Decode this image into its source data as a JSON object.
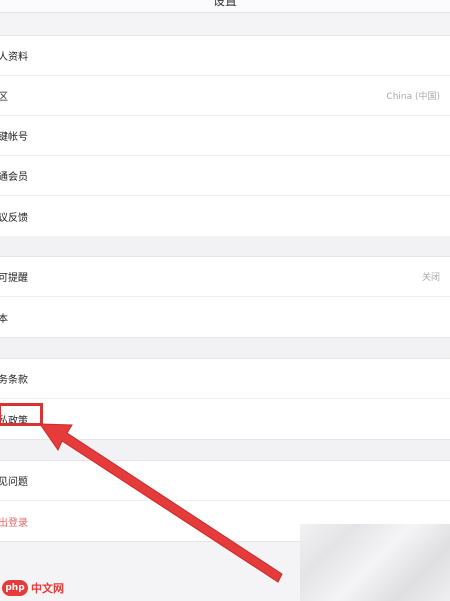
{
  "header": {
    "title": "设置"
  },
  "sections": [
    {
      "items": [
        {
          "name": "profile",
          "label": "人资料",
          "value": ""
        },
        {
          "name": "region",
          "label": "区",
          "value": "China (中国)"
        },
        {
          "name": "account",
          "label": "键帐号",
          "value": ""
        },
        {
          "name": "membership",
          "label": "通会员",
          "value": ""
        },
        {
          "name": "feedback",
          "label": "议反馈",
          "value": ""
        }
      ]
    },
    {
      "items": [
        {
          "name": "reminder",
          "label": "可提醒",
          "value": "关闭"
        },
        {
          "name": "misc",
          "label": "本",
          "value": ""
        }
      ]
    },
    {
      "items": [
        {
          "name": "terms",
          "label": "务条款",
          "value": ""
        },
        {
          "name": "privacy",
          "label": "私政策",
          "value": ""
        }
      ]
    },
    {
      "items": [
        {
          "name": "faq",
          "label": "见问题",
          "value": ""
        },
        {
          "name": "clear-data",
          "label": "出登录",
          "value": ""
        }
      ]
    }
  ],
  "gaps": [
    "",
    "",
    ""
  ],
  "watermark": {
    "logo_text": "php",
    "site_text": "中文网"
  },
  "colors": {
    "highlight": "#d63434",
    "accent": "#e53b3b"
  }
}
